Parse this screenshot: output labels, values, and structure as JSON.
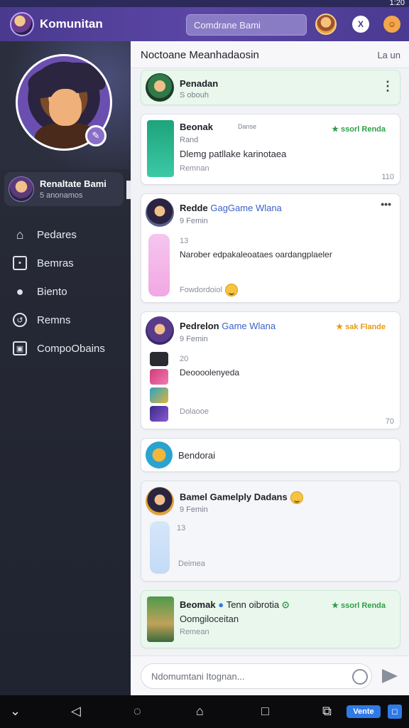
{
  "status_bar": {
    "time": "1:20"
  },
  "topbar": {
    "title": "Komunitan",
    "search_text": "Comdrane Bami",
    "icons": [
      "app-logo",
      "user-avatar",
      "x-badge-icon",
      "emoji-icon"
    ],
    "badge_label": "X"
  },
  "sidebar": {
    "profile": {
      "name": "Renaltate Bami",
      "sub": "5 anonamos"
    },
    "items": [
      {
        "label": "Pedares",
        "icon": "home-icon"
      },
      {
        "label": "Bemras",
        "icon": "square-icon"
      },
      {
        "label": "Biento",
        "icon": "person-icon"
      },
      {
        "label": "Remns",
        "icon": "clock-icon"
      },
      {
        "label": "CompoObains",
        "icon": "chat-icon"
      }
    ]
  },
  "main": {
    "title": "Noctoane Meanhadaosin",
    "lang": "La un",
    "cards": [
      {
        "name": "Penadan",
        "sub": "S obouh"
      },
      {
        "name": "Beonak",
        "time": "Danse",
        "badge": "ssorl Renda",
        "subtitle": "Rand",
        "text": "Dlemg patllake karinotaea",
        "meta": "Remnan",
        "count": "110"
      },
      {
        "name": "Redde",
        "tag": "GagGame Wlana",
        "sub": "9 Femin",
        "num": "13",
        "text": "Narober edpakaleoataes oardangplaeler",
        "meta": "Fowdordoiol"
      },
      {
        "name": "Pedrelon",
        "tag": "Game Wlana",
        "sub": "9 Femin",
        "badge": "sak Flande",
        "num": "20",
        "text": "Deoooolenyeda",
        "meta": "Dolaooe",
        "count": "70"
      },
      {
        "name": "Bendorai"
      },
      {
        "name": "Bamel Gamelply Dadans",
        "sub": "9 Femin",
        "num": "13",
        "meta": "Deimea"
      },
      {
        "name": "Beomak",
        "tag": "Tenn oibrotia",
        "badge": "ssorl Renda",
        "text": "Oomgiloceitan",
        "meta": "Remean"
      }
    ]
  },
  "composer": {
    "placeholder": "Ndomumtani Itognan..."
  },
  "sysnav": {
    "vente": "Vente",
    "sq": "◻"
  },
  "colors": {
    "accent": "#5b46a6",
    "sidebar": "#252834",
    "green_badge": "#2f9e48",
    "orange_badge": "#e59a1a",
    "blue_btn": "#2f7ae5"
  }
}
